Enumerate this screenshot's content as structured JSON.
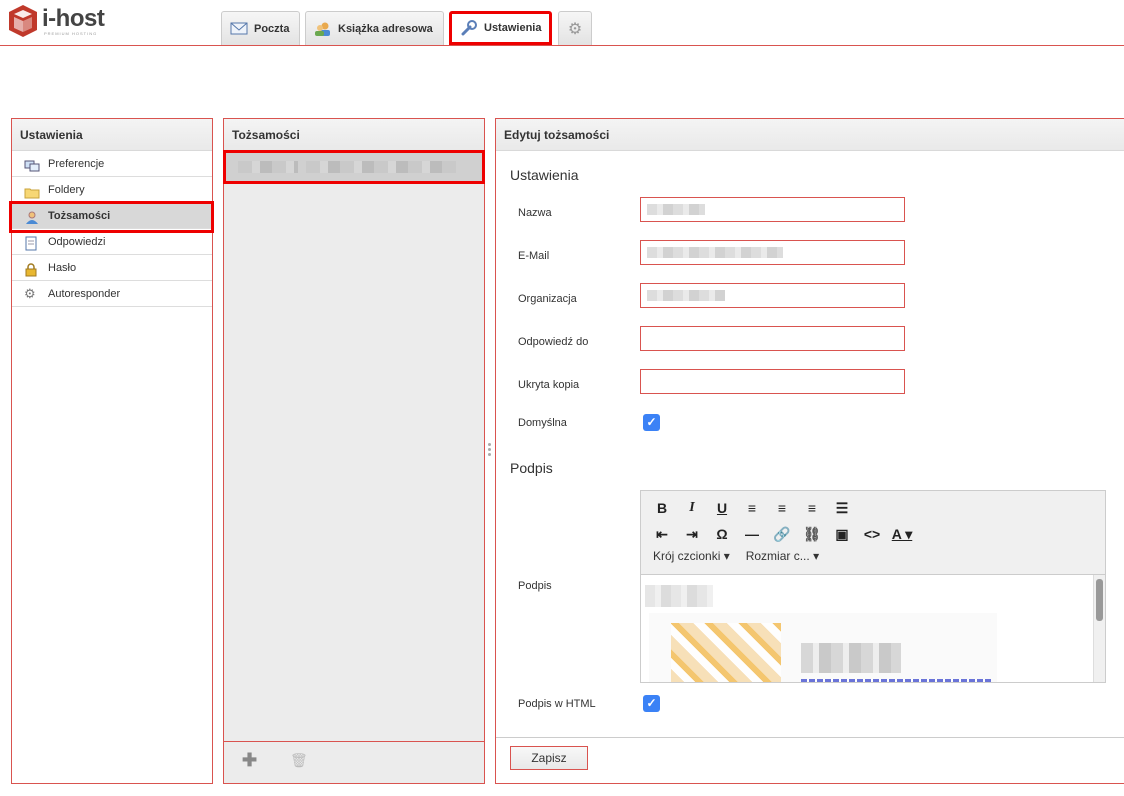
{
  "brand": {
    "name": "i-host",
    "tagline": "PREMIUM HOSTING"
  },
  "tabs": [
    {
      "label": "Poczta",
      "icon": "envelope-icon"
    },
    {
      "label": "Książka adresowa",
      "icon": "contacts-icon"
    },
    {
      "label": "Ustawienia",
      "icon": "wrench-icon"
    }
  ],
  "settings_panel": {
    "title": "Ustawienia",
    "items": [
      {
        "label": "Preferencje",
        "icon": "preferences-icon"
      },
      {
        "label": "Foldery",
        "icon": "folder-icon"
      },
      {
        "label": "Tożsamości",
        "icon": "identity-icon"
      },
      {
        "label": "Odpowiedzi",
        "icon": "document-icon"
      },
      {
        "label": "Hasło",
        "icon": "lock-icon"
      },
      {
        "label": "Autoresponder",
        "icon": "gear-icon"
      }
    ],
    "selected": "Tożsamości"
  },
  "identities_panel": {
    "title": "Tożsamości"
  },
  "edit_panel": {
    "title": "Edytuj tożsamości",
    "settings_section": "Ustawienia",
    "fields": {
      "name": {
        "label": "Nazwa"
      },
      "email": {
        "label": "E-Mail"
      },
      "organization": {
        "label": "Organizacja"
      },
      "reply_to": {
        "label": "Odpowiedź do"
      },
      "bcc": {
        "label": "Ukryta kopia"
      },
      "default": {
        "label": "Domyślna",
        "checked": true
      }
    },
    "signature_section": "Podpis",
    "signature_label": "Podpis",
    "toolbar": {
      "font_family": "Krój czcionki",
      "font_size": "Rozmiar c..."
    },
    "html_signature": {
      "label": "Podpis w HTML",
      "checked": true
    },
    "save_label": "Zapisz"
  },
  "colors": {
    "accent": "#d9534f",
    "highlight": "#ee0000",
    "checkbox": "#3b82f6"
  }
}
